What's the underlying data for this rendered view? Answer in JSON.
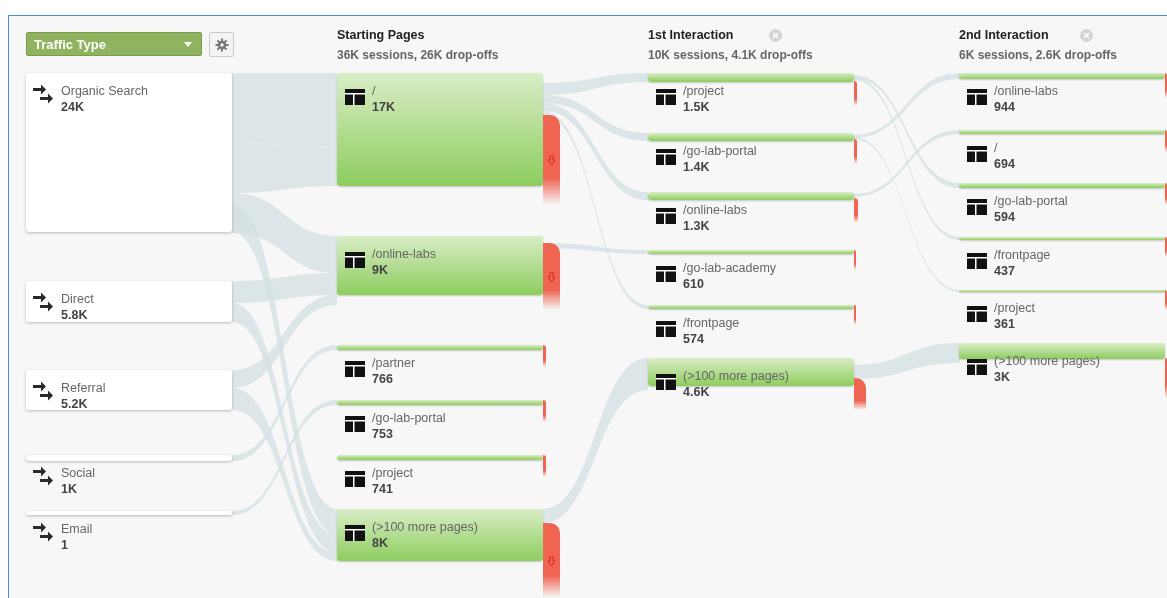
{
  "toolbar": {
    "dimension": "Traffic Type"
  },
  "sources": [
    {
      "name": "Organic Search",
      "value": "24K"
    },
    {
      "name": "Direct",
      "value": "5.8K"
    },
    {
      "name": "Referral",
      "value": "5.2K"
    },
    {
      "name": "Social",
      "value": "1K"
    },
    {
      "name": "Email",
      "value": "1"
    }
  ],
  "columns": [
    {
      "title": "Starting Pages",
      "summary": "36K sessions, 26K drop-offs",
      "closable": false,
      "nodes": [
        {
          "name": "/",
          "value": "17K"
        },
        {
          "name": "/online-labs",
          "value": "9K"
        },
        {
          "name": "/partner",
          "value": "766"
        },
        {
          "name": "/go-lab-portal",
          "value": "753"
        },
        {
          "name": "/project",
          "value": "741"
        },
        {
          "name": "(>100 more pages)",
          "value": "8K"
        }
      ]
    },
    {
      "title": "1st Interaction",
      "summary": "10K sessions, 4.1K drop-offs",
      "closable": true,
      "nodes": [
        {
          "name": "/project",
          "value": "1.5K"
        },
        {
          "name": "/go-lab-portal",
          "value": "1.4K"
        },
        {
          "name": "/online-labs",
          "value": "1.3K"
        },
        {
          "name": "/go-lab-academy",
          "value": "610"
        },
        {
          "name": "/frontpage",
          "value": "574"
        },
        {
          "name": "(>100 more pages)",
          "value": "4.6K"
        }
      ]
    },
    {
      "title": "2nd Interaction",
      "summary": "6K sessions, 2.6K drop-offs",
      "closable": true,
      "nodes": [
        {
          "name": "/online-labs",
          "value": "944"
        },
        {
          "name": "/",
          "value": "694"
        },
        {
          "name": "/go-lab-portal",
          "value": "594"
        },
        {
          "name": "/frontpage",
          "value": "437"
        },
        {
          "name": "/project",
          "value": "361"
        },
        {
          "name": "(>100 more pages)",
          "value": "3K"
        }
      ]
    }
  ]
}
